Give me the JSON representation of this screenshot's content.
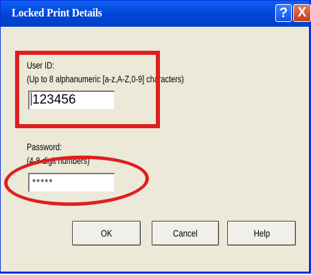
{
  "window": {
    "title": "Locked Print Details",
    "help_glyph": "?",
    "close_glyph": "X"
  },
  "user_id": {
    "label": "User ID:",
    "hint": "(Up to 8 alphanumeric [a-z,A-Z,0-9] characters)",
    "value": "123456"
  },
  "password": {
    "label": "Password:",
    "hint": "(4-8 digit numbers)",
    "value": "*****"
  },
  "buttons": {
    "ok": "OK",
    "cancel": "Cancel",
    "help": "Help"
  },
  "annotations": {
    "color": "#e01e1e"
  }
}
